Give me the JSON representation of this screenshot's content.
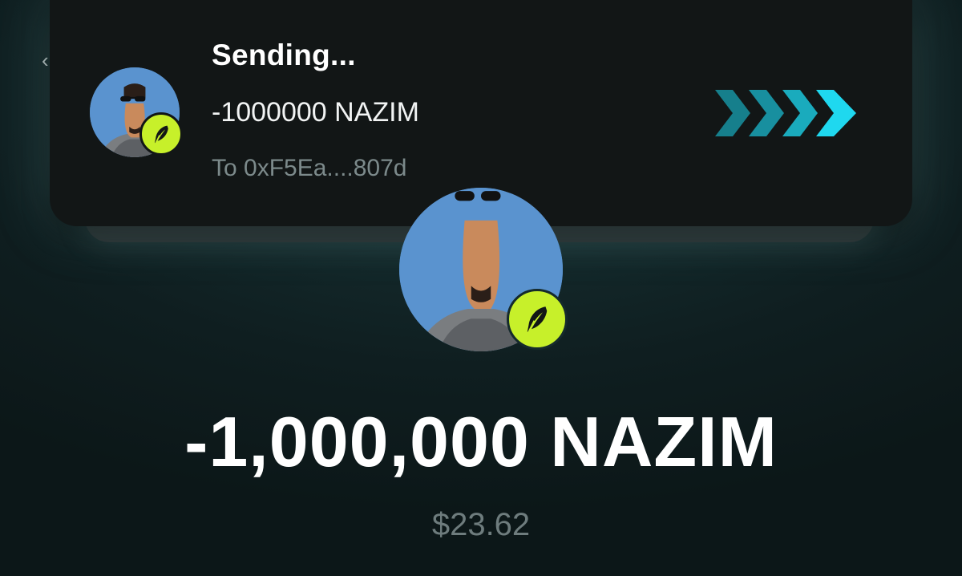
{
  "nav": {
    "back_glyph": "‹"
  },
  "toast": {
    "title": "Sending...",
    "amount": "-1000000 NAZIM",
    "recipient": "To 0xF5Ea....807d",
    "progress_icon": "chevrons-right-icon",
    "avatar_badge_icon": "feather-icon"
  },
  "transaction": {
    "amount": "-1,000,000 NAZIM",
    "fiat_value": "$23.62",
    "avatar_badge_icon": "feather-icon"
  },
  "colors": {
    "badge": "#c7f02a",
    "arrow_light": "#1fd8ef",
    "arrow_dark": "#167f8c",
    "avatar_bg": "#4e88c6"
  }
}
